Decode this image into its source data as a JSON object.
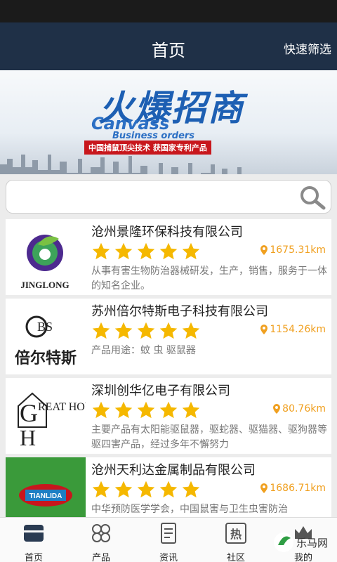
{
  "header": {
    "title": "首页",
    "action": "快速筛选"
  },
  "banner": {
    "cn": "火爆招商",
    "en": "Canvass",
    "en2": "Business orders",
    "tag": "中国捕鼠顶尖技术 获国家专利产品"
  },
  "search": {
    "placeholder": "",
    "value": ""
  },
  "companies": [
    {
      "name": "沧州景隆环保科技有限公司",
      "rating": 5,
      "distance": "1675.31km",
      "desc": "从事有害生物防治器械研发，生产，销售，服务于一体的知名企业。",
      "logo_text": "JINGLONG",
      "logo_icon": "jinglong-logo"
    },
    {
      "name": "苏州倍尔特斯电子科技有限公司",
      "rating": 5,
      "distance": "1154.26km",
      "desc": "产品用途：蚊 虫 驱鼠器",
      "logo_text": "倍尔特斯",
      "logo_icon": "bs-logo"
    },
    {
      "name": "深圳创华亿电子有限公司",
      "rating": 5,
      "distance": "80.76km",
      "desc": "主要产品有太阳能驱鼠器，驱蛇器、驱猫器、驱狗器等驱四害产品，经过多年不懈努力",
      "logo_text": "REAT HOUSE",
      "logo_icon": "great-house-logo"
    },
    {
      "name": "沧州天利达金属制品有限公司",
      "rating": 5,
      "distance": "1686.71km",
      "desc": "中华预防医学学会，中国鼠害与卫生虫害防治",
      "logo_text": "TIANLIDA",
      "logo_icon": "tianlida-logo"
    }
  ],
  "tabs": [
    {
      "label": "首页",
      "icon": "home-icon"
    },
    {
      "label": "产品",
      "icon": "products-icon"
    },
    {
      "label": "资讯",
      "icon": "news-icon"
    },
    {
      "label": "社区",
      "icon": "community-icon"
    },
    {
      "label": "我的",
      "icon": "profile-icon"
    }
  ],
  "watermark": "乐马网",
  "colors": {
    "nav": "#1f3047",
    "star": "#f5b800",
    "distance": "#f0a020"
  }
}
